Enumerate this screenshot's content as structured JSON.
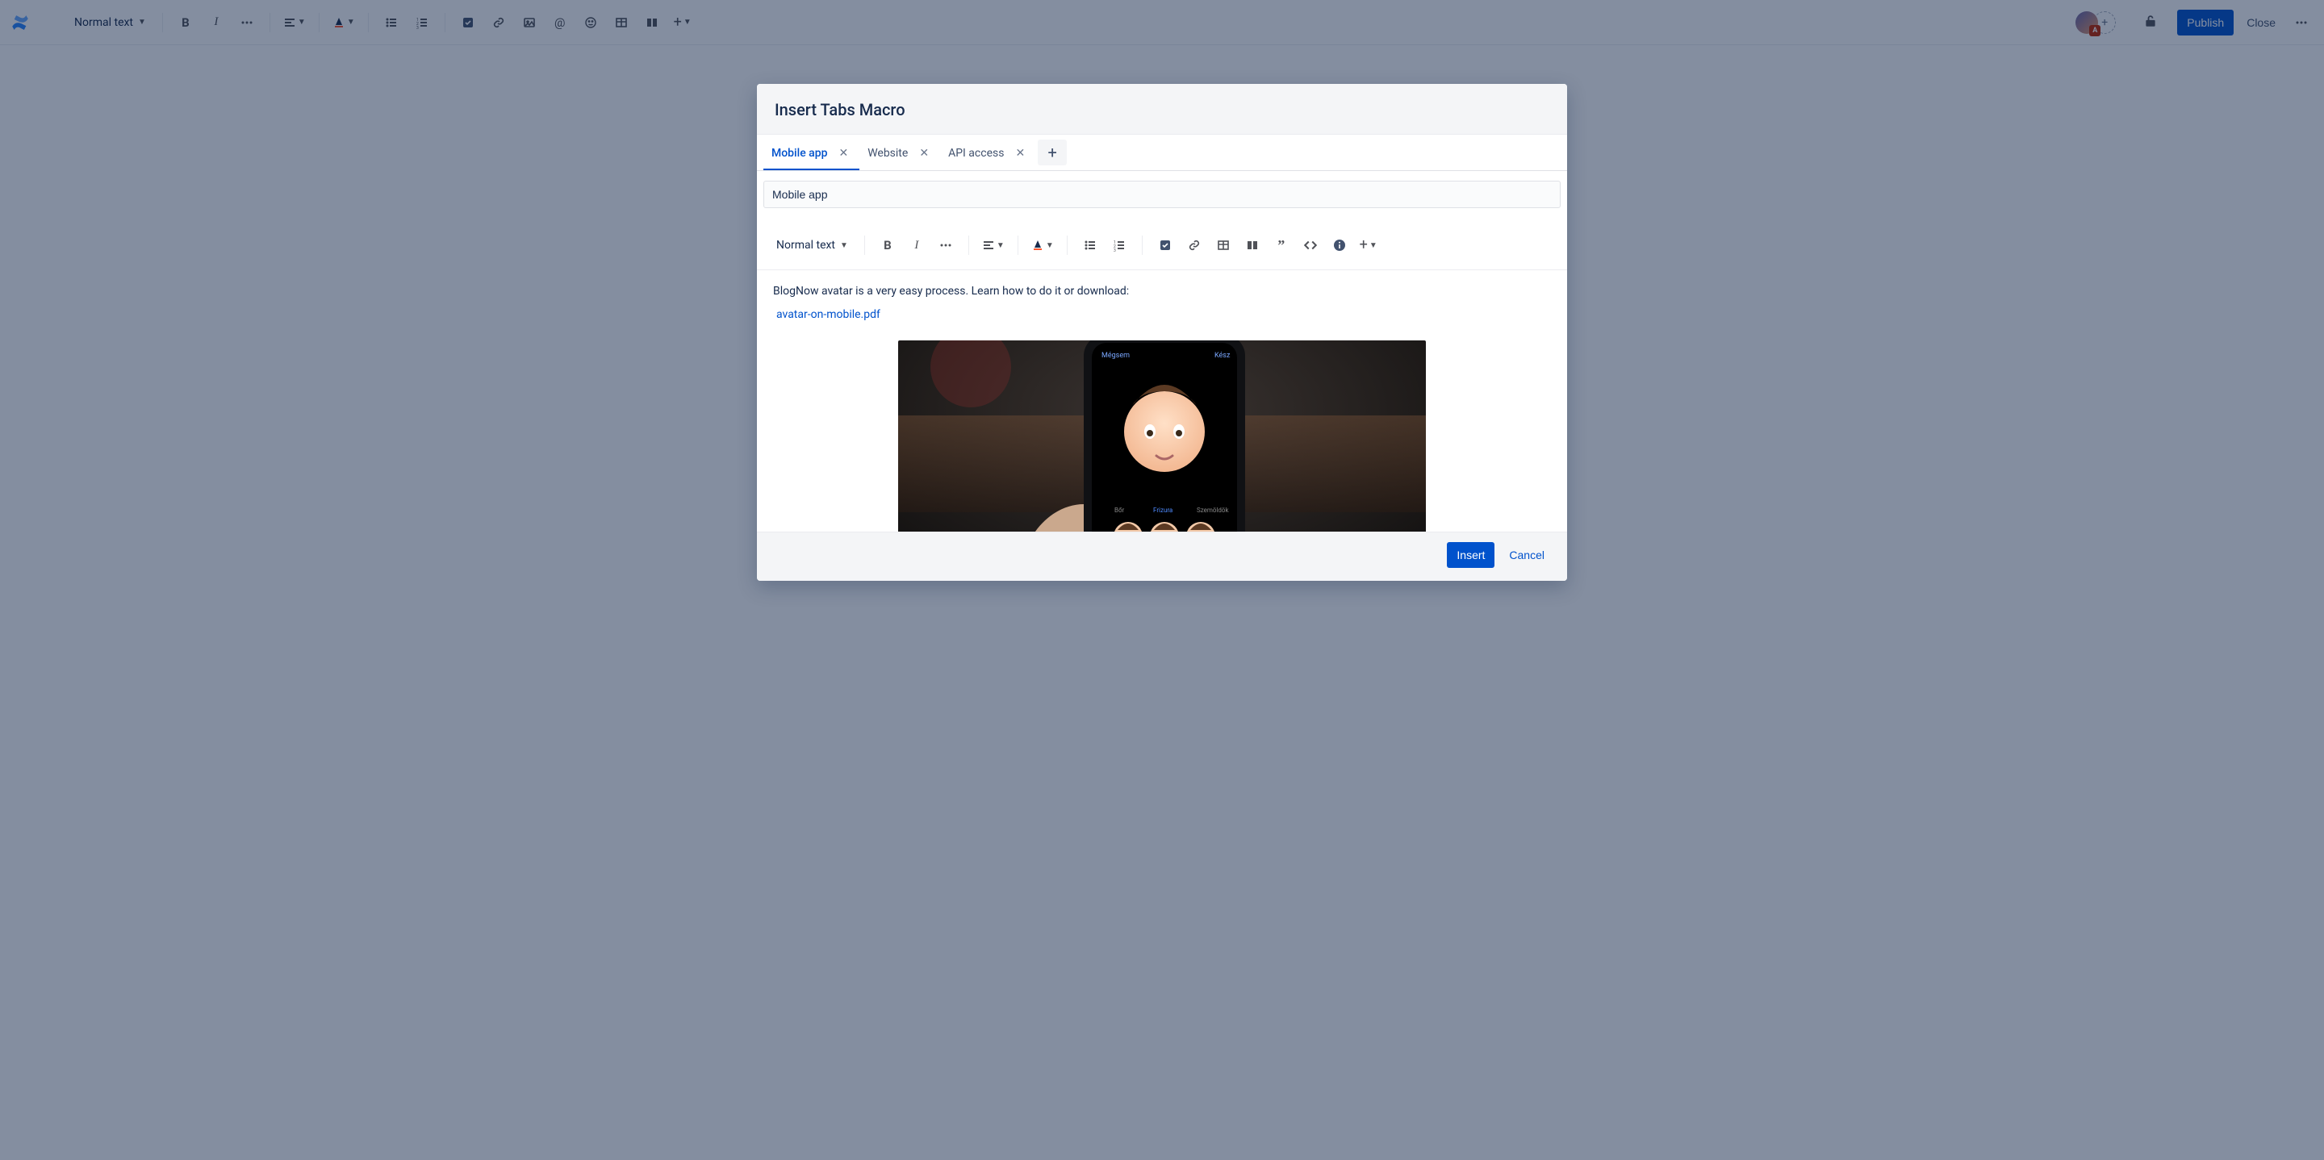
{
  "outer_toolbar": {
    "text_style_label": "Normal text",
    "publish_label": "Publish",
    "close_label": "Close",
    "avatar_badge": "A"
  },
  "modal": {
    "title": "Insert Tabs Macro",
    "tabs": [
      {
        "label": "Mobile app",
        "active": true
      },
      {
        "label": "Website",
        "active": false
      },
      {
        "label": "API access",
        "active": false
      }
    ],
    "tab_name_value": "Mobile app",
    "inner_text_style_label": "Normal text",
    "body_text": "BlogNow avatar is a very easy process. Learn how to do it or download:",
    "attachment_link": "avatar-on-mobile.pdf",
    "insert_label": "Insert",
    "cancel_label": "Cancel"
  }
}
